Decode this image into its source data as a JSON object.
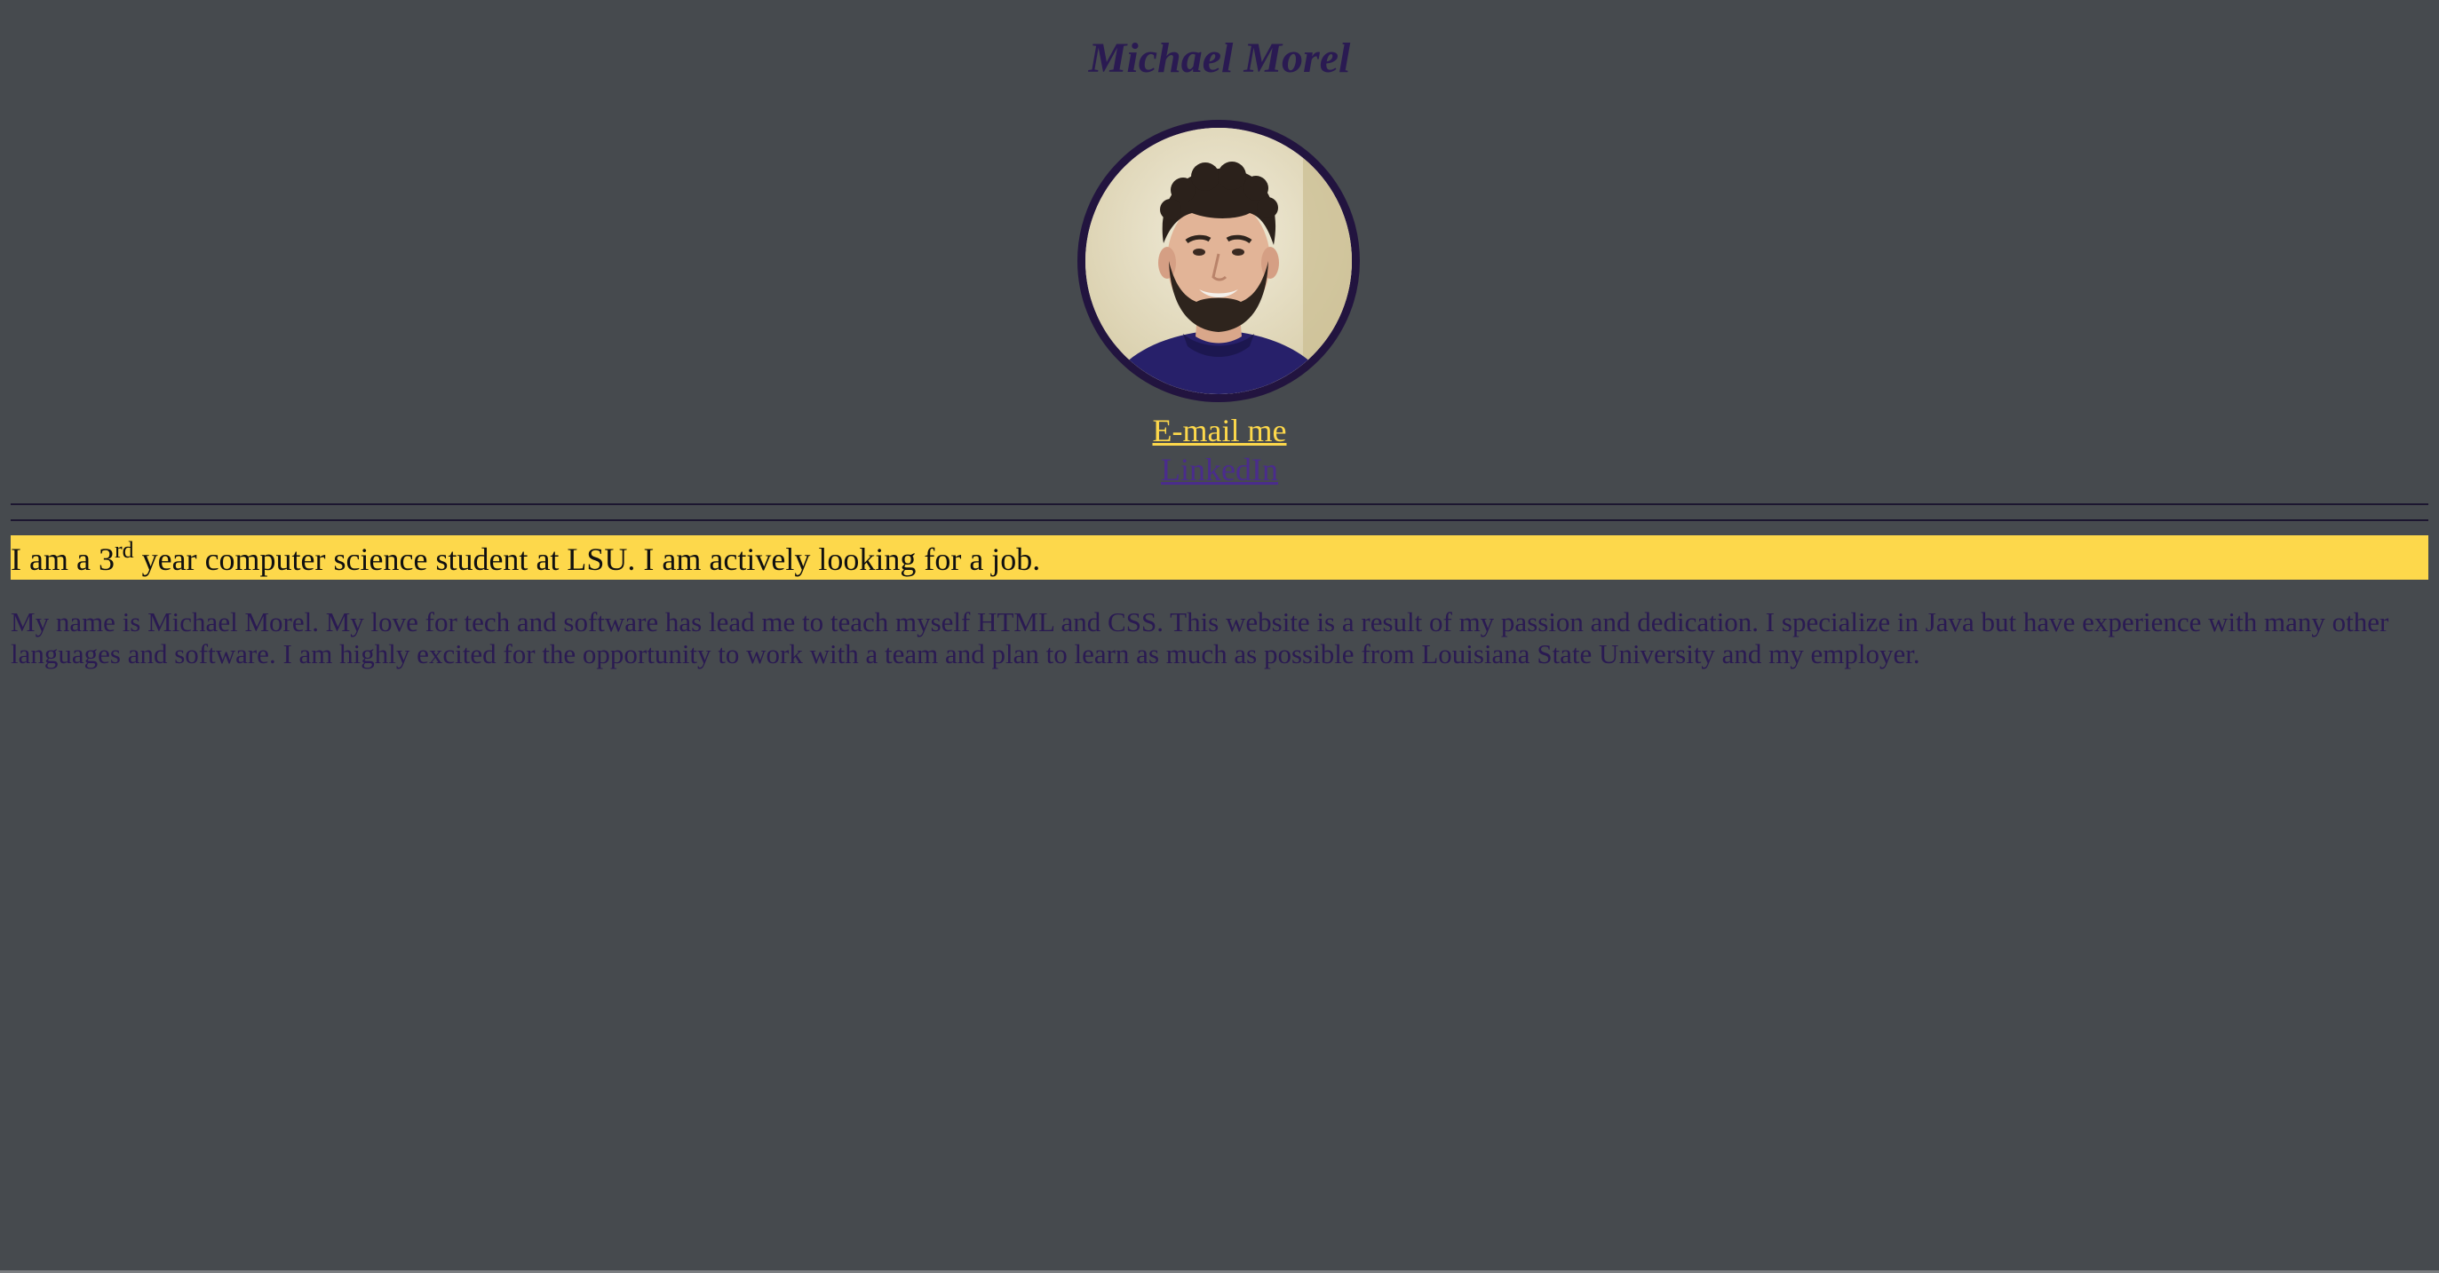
{
  "header": {
    "title": "Michael Morel"
  },
  "links": {
    "email_label": "E-mail me",
    "linkedin_label": "LinkedIn"
  },
  "highlight": {
    "text_before": "I am a 3",
    "superscript": "rd",
    "text_after": " year computer science student at LSU. I am actively looking for a job."
  },
  "bio": {
    "text": "My name is Michael Morel. My love for tech and software has lead me to teach myself HTML and CSS. This website is a result of my passion and dedication. I specialize in Java but have experience with many other languages and software. I am highly excited for the opportunity to work with a team and plan to learn as much as possible from Louisiana State University and my employer."
  },
  "colors": {
    "background": "#464a4e",
    "title": "#2a1a52",
    "email_link": "#fdd84b",
    "linkedin_link": "#4a2c8c",
    "highlight_background": "#fdd84b",
    "avatar_border": "#22143f"
  },
  "avatar": {
    "icon": "profile-photo"
  }
}
